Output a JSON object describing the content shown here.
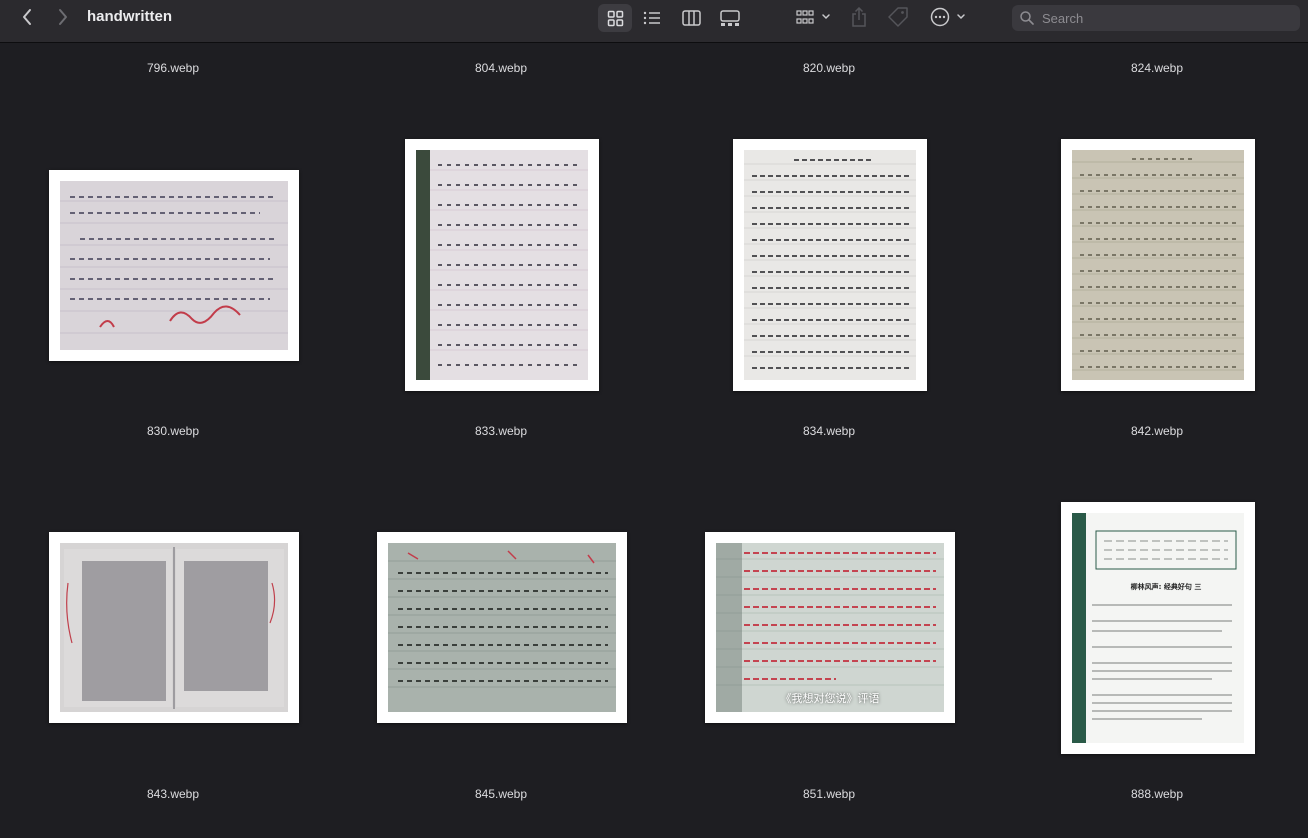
{
  "window": {
    "title": "handwritten"
  },
  "toolbar": {
    "nav": [
      "chevron-left-icon",
      "chevron-right-icon"
    ],
    "views": [
      "icon-view",
      "list-view",
      "column-view",
      "gallery-view"
    ],
    "active_view": "icon-view",
    "actions": [
      "group-icon",
      "share-icon",
      "tag-icon",
      "more-icon"
    ]
  },
  "search": {
    "placeholder": "Search"
  },
  "top_row": [
    "796.webp",
    "804.webp",
    "820.webp",
    "824.webp"
  ],
  "files": [
    {
      "name": "830.webp",
      "label": ""
    },
    {
      "name": "833.webp",
      "label": ""
    },
    {
      "name": "834.webp",
      "label": ""
    },
    {
      "name": "842.webp",
      "label": ""
    },
    {
      "name": "843.webp",
      "label": ""
    },
    {
      "name": "845.webp",
      "label": ""
    },
    {
      "name": "851.webp",
      "label": "《我想对您说》评语"
    },
    {
      "name": "888.webp",
      "label": "柳林风声: 经典好句 三"
    }
  ],
  "colors": {
    "background": "#1e1e22",
    "toolbar": "#2b2a2e",
    "text": "#dcdcdf"
  }
}
